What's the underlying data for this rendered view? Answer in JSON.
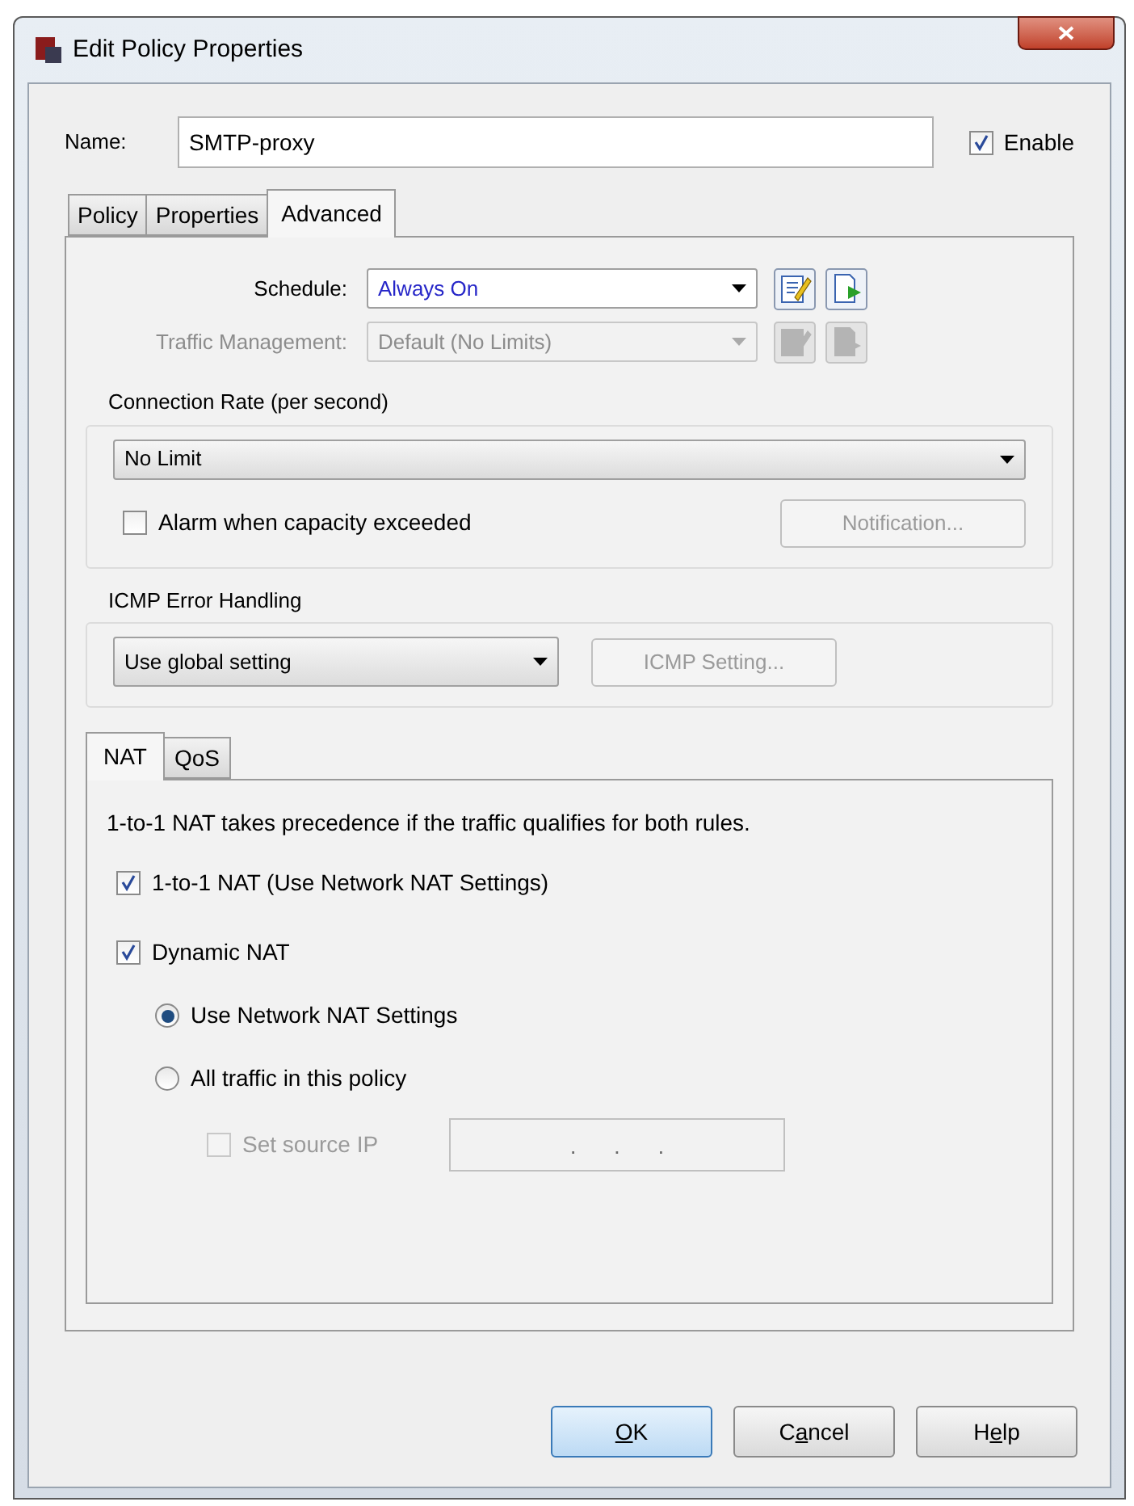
{
  "window": {
    "title": "Edit Policy Properties"
  },
  "name_field": {
    "label": "Name:",
    "value": "SMTP-proxy"
  },
  "enable": {
    "label": "Enable",
    "checked": true
  },
  "tabs": [
    {
      "label": "Policy",
      "selected": false
    },
    {
      "label": "Properties",
      "selected": false
    },
    {
      "label": "Advanced",
      "selected": true
    }
  ],
  "schedule": {
    "label": "Schedule:",
    "value": "Always On",
    "disabled": false
  },
  "traffic_management": {
    "label": "Traffic Management:",
    "value": "Default (No Limits)",
    "disabled": true
  },
  "connection_rate": {
    "title": "Connection Rate (per second)",
    "value": "No Limit",
    "alarm": {
      "label": "Alarm when capacity exceeded",
      "checked": false
    },
    "notification_button": {
      "label": "Notification...",
      "disabled": true
    }
  },
  "icmp": {
    "title": "ICMP Error Handling",
    "value": "Use global setting",
    "setting_button": {
      "label": "ICMP Setting...",
      "disabled": true
    }
  },
  "sub_tabs": [
    {
      "label": "NAT",
      "selected": true
    },
    {
      "label": "QoS",
      "selected": false
    }
  ],
  "nat": {
    "note": "1-to-1 NAT takes precedence if the traffic qualifies for both rules.",
    "one_to_one": {
      "label": "1-to-1 NAT (Use Network NAT Settings)",
      "checked": true
    },
    "dynamic": {
      "label": "Dynamic NAT",
      "checked": true
    },
    "options": [
      {
        "label": "Use Network NAT Settings",
        "selected": true
      },
      {
        "label": "All traffic in this policy",
        "selected": false
      }
    ],
    "source_ip": {
      "label": "Set source IP",
      "checked": false,
      "disabled": true,
      "placeholder": ".      .      ."
    }
  },
  "buttons": [
    {
      "key": "O",
      "after": "K",
      "default": true
    },
    {
      "before": "C",
      "key": "a",
      "after": "ncel",
      "default": false
    },
    {
      "before": "H",
      "key": "e",
      "after": "lp",
      "default": false
    }
  ]
}
